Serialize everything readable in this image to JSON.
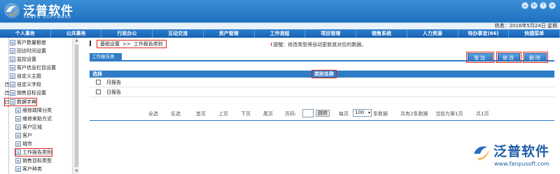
{
  "header": {
    "brand_cn": "泛普软件",
    "brand_en": "FANPU SOFTWARE",
    "user_info": "杨勇：2016年5月24日 星期"
  },
  "nav": [
    "个人事务",
    "公共事务",
    "行政办公",
    "互动交流",
    "资产管理",
    "工作流程",
    "项目管理",
    "销售系统",
    "人力资源",
    "待办事宜(66)",
    "快捷菜单"
  ],
  "sidebar": {
    "items": [
      {
        "label": "客户数量额度",
        "type": "leaf"
      },
      {
        "label": "回访时间设置",
        "type": "leaf"
      },
      {
        "label": "监控设置",
        "type": "leaf"
      },
      {
        "label": "客户信息栏目设置",
        "type": "leaf"
      },
      {
        "label": "自定义主题",
        "type": "leaf"
      },
      {
        "label": "自定义字段",
        "type": "expand",
        "sign": "+"
      },
      {
        "label": "销售目标设置",
        "type": "expand",
        "sign": "+"
      },
      {
        "label": "数据字典",
        "type": "expand",
        "sign": "−"
      },
      {
        "label": "维修故障分类",
        "type": "leaf"
      },
      {
        "label": "维修来助方式",
        "type": "leaf"
      },
      {
        "label": "客户区域",
        "type": "leaf"
      },
      {
        "label": "客户",
        "type": "leaf"
      },
      {
        "label": "城市",
        "type": "leaf"
      },
      {
        "label": "工作报告类别",
        "type": "leaf"
      },
      {
        "label": "销售目标类型",
        "type": "leaf"
      },
      {
        "label": "客户种类",
        "type": "leaf"
      }
    ]
  },
  "breadcrumb": {
    "root": "基础设置",
    "sep": ">>",
    "current": "工作报告类别"
  },
  "tip": "提醒：修改类型将自动更新其对应的数据。",
  "tab": {
    "label": "工作报告类"
  },
  "toolbar": {
    "add_label": "增加",
    "edit_label": "修改",
    "delete_label": "删除"
  },
  "table": {
    "headers": {
      "select": "选择",
      "name": "类别名称"
    },
    "rows": [
      {
        "name": "月报告"
      },
      {
        "name": "日报告"
      }
    ]
  },
  "pager": {
    "select_all": "全选",
    "invert": "反选",
    "first": "首页",
    "prev": "上页",
    "next": "下页",
    "last": "尾页",
    "page_label": "页码:",
    "go": "跳转",
    "per_page_label": "每页",
    "per_page_value": "100",
    "per_page_suffix": "条数据",
    "total": "共有2条数据",
    "current": "当前为第1页",
    "pages": "共1页"
  },
  "watermark": {
    "cn": "泛普软件",
    "url": "www.fanpusoft.com"
  },
  "colors": {
    "primary": "#2f7cc7",
    "highlight": "#d8261e",
    "header": "#1f6fbf"
  }
}
